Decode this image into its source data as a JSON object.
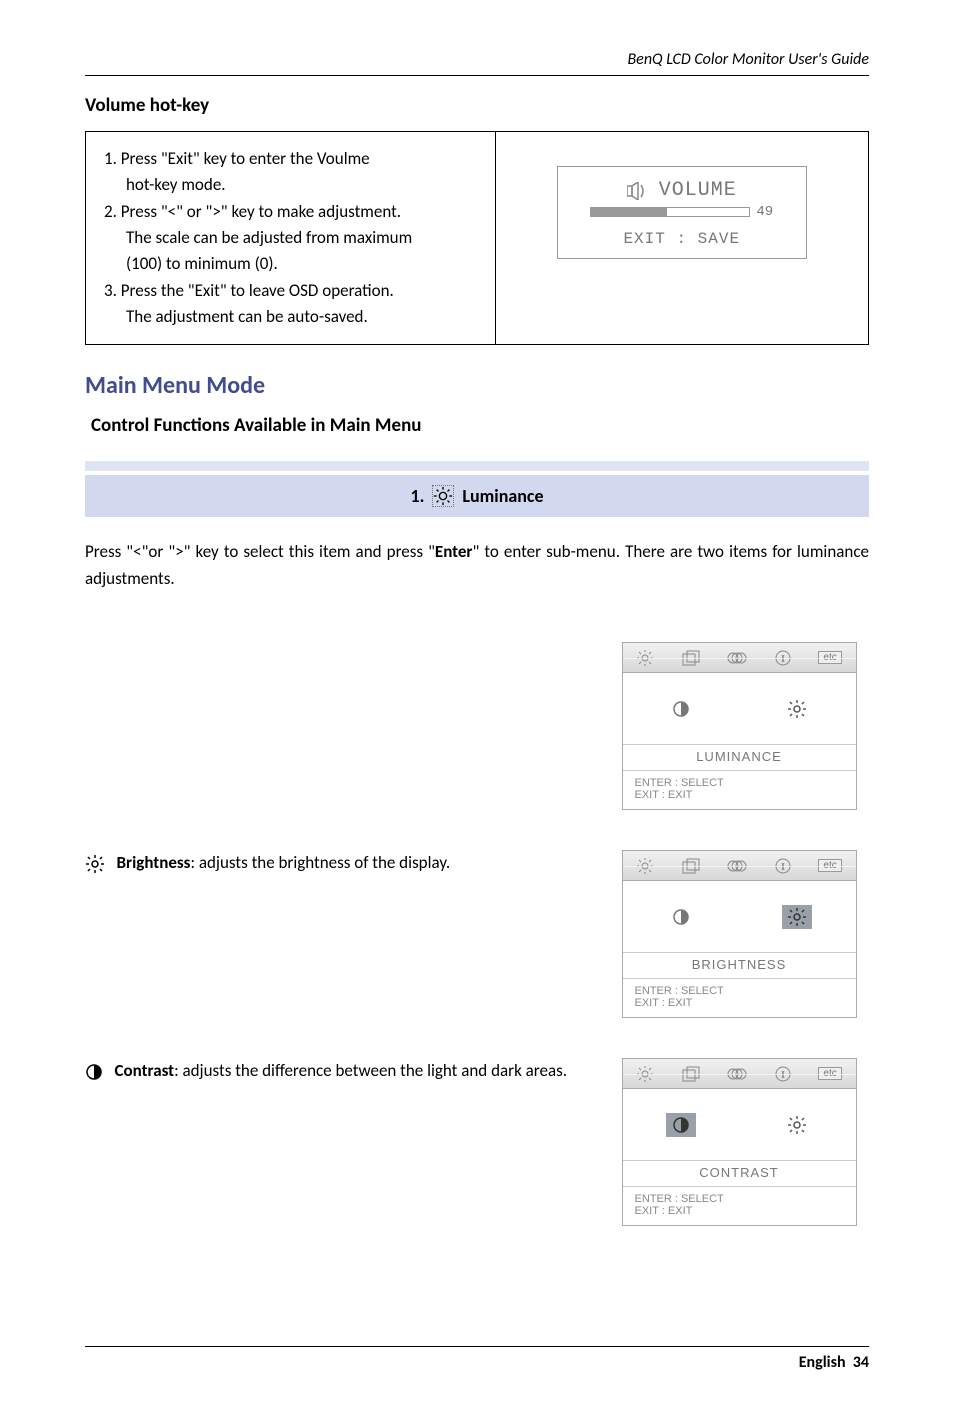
{
  "header": "BenQ LCD Color Monitor User's Guide",
  "section_volume_title": "Volume hot-key",
  "volume_steps": {
    "s1a": "1. Press \"Exit\" key to enter the Voulme",
    "s1b": "hot-key mode.",
    "s2a": "2. Press \"<\"  or  \">\" key to make adjustment.",
    "s2b": "The scale can be adjusted from maximum",
    "s2c": "(100) to minimum (0).",
    "s3a": "3. Press the \"Exit\" to leave OSD operation.",
    "s3b": "The adjustment can be auto-saved."
  },
  "osd_volume": {
    "title": "VOLUME",
    "value": "49",
    "exit": "EXIT : SAVE"
  },
  "main_menu_title": "Main Menu Mode",
  "main_menu_sub": "Control Functions Available in Main Menu",
  "tab": {
    "number": "1.",
    "label": "Luminance"
  },
  "tab_text": {
    "pre": "Press  \"<\"or \">\" key to select this item and press  \"",
    "bold": "Enter",
    "post": "\" to enter sub-menu. There are two items for luminance adjustments."
  },
  "brightness_row": {
    "bold": "Brightness",
    "rest": ": adjusts the brightness of the display."
  },
  "contrast_row": {
    "bold": "Contrast",
    "rest": ": adjusts the difference between the light and dark areas."
  },
  "osd_panel": {
    "luminance_label": "LUMINANCE",
    "brightness_label": "BRIGHTNESS",
    "contrast_label": "CONTRAST",
    "enter_line": "ENTER : SELECT",
    "exit_line": "EXIT : EXIT",
    "etc": "etc"
  },
  "footer": {
    "lang": "English",
    "page": "34"
  }
}
